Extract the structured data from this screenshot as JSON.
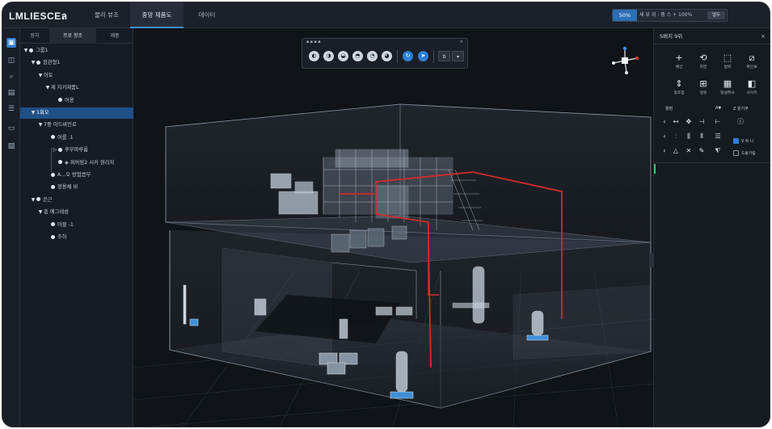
{
  "app": {
    "logo": "LMLIESCEล",
    "nav": [
      {
        "label": "물리 뷰조"
      },
      {
        "label": "중앙 제품도"
      },
      {
        "label": "데이터"
      }
    ],
    "zoom": {
      "percent": "50%",
      "text": "새 뷰 위 : 줌 스 + 100%",
      "button": "열두"
    }
  },
  "rail": {
    "icons": [
      "layers-icon",
      "cube-icon",
      "search-object-icon",
      "table-icon",
      "list-icon",
      "folder-icon",
      "settings-doc-icon"
    ]
  },
  "tree": {
    "tabs": [
      {
        "label": "장치"
      },
      {
        "label": "프로 항조"
      },
      {
        "label": "제품"
      }
    ],
    "rows": [
      {
        "label": "그룹1",
        "depth": 0,
        "toggle": "▼",
        "icon": "dot"
      },
      {
        "label": "정관형1",
        "depth": 1,
        "toggle": "▼",
        "icon": "dot"
      },
      {
        "label": "어토",
        "depth": 2,
        "toggle": "▼",
        "icon": ""
      },
      {
        "label": "제 지키제품L",
        "depth": 3,
        "toggle": "▼",
        "icon": ""
      },
      {
        "label": "어용",
        "depth": 4,
        "toggle": "",
        "icon": "dot"
      },
      {
        "label": "1회오",
        "depth": 1,
        "toggle": "▼",
        "icon": "",
        "selected": true
      },
      {
        "label": "7중 아드바인로",
        "depth": 2,
        "toggle": "▼",
        "icon": ""
      },
      {
        "label": "어룹 .1",
        "depth": 3,
        "toggle": "",
        "icon": "dot"
      },
      {
        "label": "후부마루룸",
        "depth": 4,
        "toggle": "▷",
        "icon": "dot"
      },
      {
        "label": "◈ 퍼버링2 시커 원리저",
        "depth": 4,
        "toggle": "",
        "icon": "dot"
      },
      {
        "label": "A...오 방험콤부",
        "depth": 3,
        "toggle": "",
        "icon": "dot"
      },
      {
        "label": "정용체 비",
        "depth": 3,
        "toggle": "",
        "icon": "dot"
      },
      {
        "label": "콘근",
        "depth": 1,
        "toggle": "▼",
        "icon": "dot"
      },
      {
        "label": "흥 에그레성",
        "depth": 2,
        "toggle": "▼",
        "icon": ""
      },
      {
        "label": "아블 -1",
        "depth": 3,
        "toggle": "",
        "icon": "dot"
      },
      {
        "label": "주하",
        "depth": 3,
        "toggle": "",
        "icon": "dot"
      }
    ]
  },
  "floor_toolbar": {
    "title": "▪ ▪ ▪ ▪",
    "close": "×"
  },
  "right_panel": {
    "title": "S배치 9위",
    "close": "×",
    "tools_row1": [
      {
        "glyph": "+",
        "label": "배신"
      },
      {
        "glyph": "⟲",
        "label": "회전"
      },
      {
        "glyph": "⬚",
        "label": "범위"
      },
      {
        "glyph": "⧄",
        "label": "확인보"
      }
    ],
    "tools_row2": [
      {
        "glyph": "⇕",
        "label": "정조점"
      },
      {
        "glyph": "⊞",
        "label": "정유"
      },
      {
        "glyph": "▦",
        "label": "항설취사"
      },
      {
        "glyph": "◧",
        "label": "사이저"
      }
    ],
    "section_labels": [
      "활편",
      "A▼",
      "Z 원기부"
    ],
    "checks": [
      {
        "label": "V 목 니",
        "checked": true
      },
      {
        "label": "드볼기림",
        "checked": false
      }
    ]
  }
}
